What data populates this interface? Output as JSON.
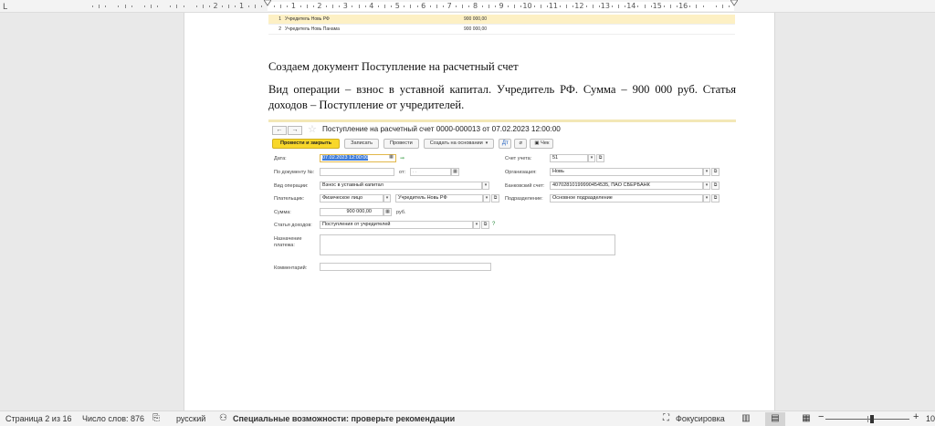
{
  "ruler": {
    "corner_glyph": "L",
    "left_numbers": [
      "2",
      "1"
    ],
    "right_numbers": [
      "1",
      "2",
      "3",
      "4",
      "5",
      "6",
      "7",
      "8",
      "9",
      "10",
      "11",
      "12",
      "13",
      "14",
      "15",
      "16"
    ]
  },
  "document": {
    "table_rows": [
      {
        "n": "1",
        "name": "Учредитель Новь РФ",
        "amount": "900 000,00"
      },
      {
        "n": "2",
        "name": "Учредитель Новь Панама",
        "amount": "900 000,00"
      }
    ],
    "paragraph1": "Создаем документ Поступление на расчетный счет",
    "paragraph2": "Вид операции – взнос в уставной капитал. Учредитель РФ. Сумма – 900 000 руб. Статья доходов – Поступление от учредителей."
  },
  "form": {
    "title": "Поступление на расчетный счет 0000-000013 от 07.02.2023 12:00:00",
    "nav": {
      "back": "←",
      "forward": "→"
    },
    "toolbar": {
      "post_close": "Провести и закрыть",
      "save": "Записать",
      "post": "Провести",
      "create_based": "Создать на основании",
      "check": "Чек"
    },
    "fields": {
      "date_label": "Дата:",
      "date_value": "07.02.2023 12:00:00",
      "doc_number_label": "По документу №:",
      "from_label": "от:",
      "from_placeholder": ". .",
      "operation_label": "Вид операции:",
      "operation_value": "Взнос в уставный капитал",
      "payer_label": "Плательщик:",
      "payer_type": "Физическое лицо",
      "payer_value": "Учредитель Новь РФ",
      "sum_label": "Сумма:",
      "sum_value": "900 000,00",
      "currency": "руб.",
      "income_label": "Статья доходов:",
      "income_value": "Поступления от учредителей",
      "purpose_label_1": "Назначение",
      "purpose_label_2": "платежа:",
      "comment_label": "Комментарий:",
      "account_label": "Счет учета:",
      "account_value": "51",
      "org_label": "Организация:",
      "org_value": "Новь",
      "bank_label": "Банковский счет:",
      "bank_value": "40702810199990454535, ПАО СБЕРБАНК",
      "division_label": "Подразделение:",
      "division_value": "Основное подразделение",
      "help": "?"
    }
  },
  "status": {
    "page": "Страница 2 из 16",
    "words": "Число слов: 876",
    "language": "русский",
    "accessibility": "Специальные возможности: проверьте рекомендации",
    "focus": "Фокусировка",
    "zoom_minus": "−",
    "zoom_plus": "+",
    "zoom_value": "10"
  },
  "colors": {
    "primary_button": "#f8d72a",
    "table_highlight": "#fdf0c4",
    "selection": "#3d7bd9"
  }
}
